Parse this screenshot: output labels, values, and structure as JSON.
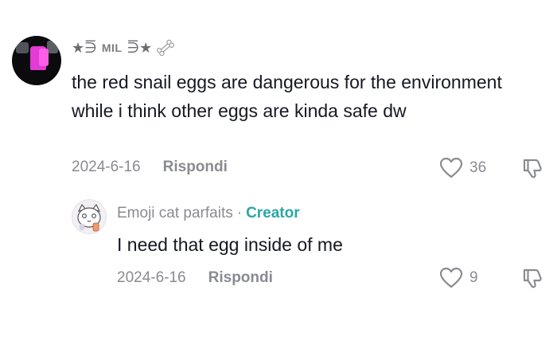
{
  "comment": {
    "username_prefix": "★⋽",
    "username_mid": "MIL",
    "username_suffix": "⋽★",
    "text": "the red snail eggs are dangerous for the environment while i think other eggs are kinda safe dw",
    "date": "2024-6-16",
    "reply_label": "Rispondi",
    "likes": "36"
  },
  "reply": {
    "author": "Emoji cat parfaits",
    "separator": "·",
    "creator_badge": "Creator",
    "text": "I need that egg inside of me",
    "date": "2024-6-16",
    "reply_label": "Rispondi",
    "likes": "9"
  },
  "icons": {
    "like": "heart-outline-icon",
    "dislike": "thumbs-down-icon",
    "bone": "bone-icon"
  },
  "colors": {
    "text": "#161823",
    "muted": "#8a8b91",
    "creator": "#2ba6a6",
    "avatar_pink": "#e33bd6"
  }
}
